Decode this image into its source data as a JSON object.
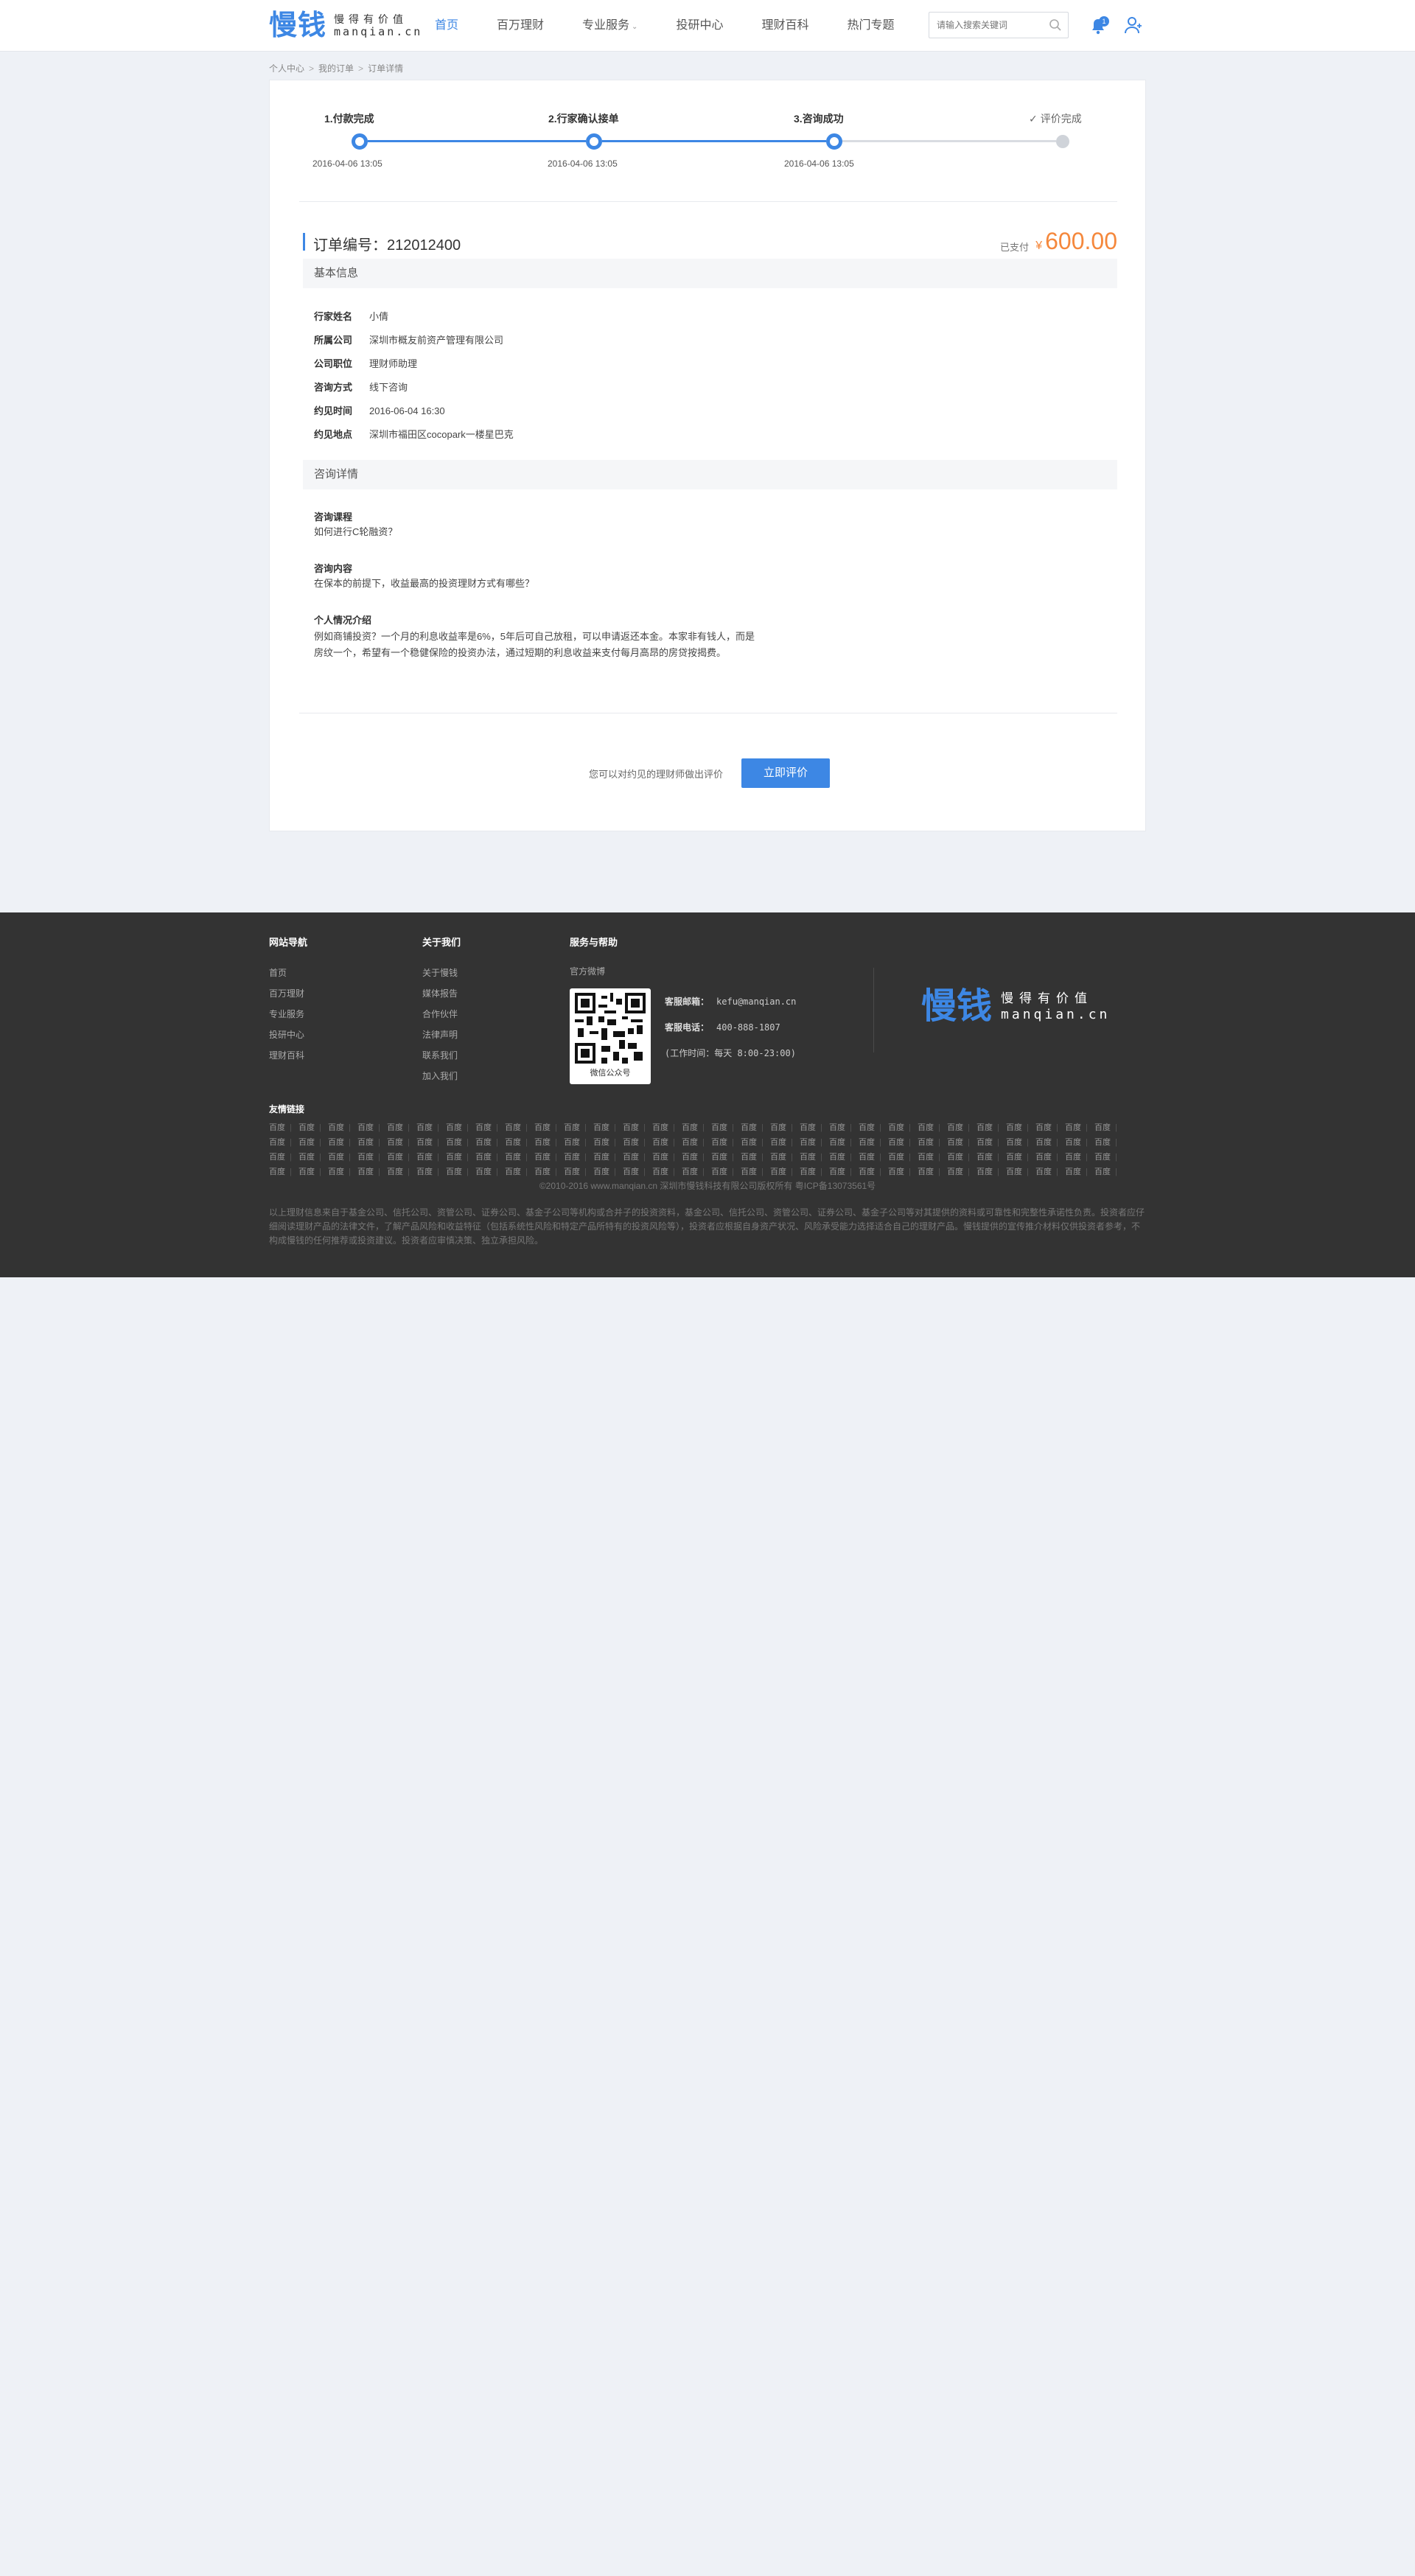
{
  "header": {
    "logo_cn": "慢钱",
    "logo_slogan": "慢得有价值",
    "logo_domain": "manqian.cn",
    "nav": [
      "首页",
      "百万理财",
      "专业服务",
      "投研中心",
      "理财百科",
      "热门专题"
    ],
    "search_placeholder": "请输入搜索关键词",
    "notification_count": "1"
  },
  "breadcrumb": [
    "个人中心",
    "我的订单",
    "订单详情"
  ],
  "progress": {
    "steps": [
      {
        "title": "1.付款完成",
        "date": "2016-04-06 13:05",
        "done": true
      },
      {
        "title": "2.行家确认接单",
        "date": "2016-04-06 13:05",
        "done": true
      },
      {
        "title": "3.咨询成功",
        "date": "2016-04-06 13:05",
        "done": true
      },
      {
        "title": "评价完成",
        "date": "",
        "done": false
      }
    ]
  },
  "order": {
    "label": "订单编号：212012400",
    "paid_label": "已支付",
    "currency": "¥",
    "amount": "600.00"
  },
  "basic_info": {
    "title": "基本信息",
    "rows": [
      {
        "label": "行家姓名",
        "value": "小倩"
      },
      {
        "label": "所属公司",
        "value": "深圳市概友前资产管理有限公司"
      },
      {
        "label": "公司职位",
        "value": "理财师助理"
      },
      {
        "label": "咨询方式",
        "value": "线下咨询"
      },
      {
        "label": "约见时间",
        "value": "2016-06-04 16:30"
      },
      {
        "label": "约见地点",
        "value": "深圳市福田区cocopark一楼星巴克"
      }
    ]
  },
  "consult_detail": {
    "title": "咨询详情",
    "course_title": "咨询课程",
    "course_text": "如何进行C轮融资？",
    "content_title": "咨询内容",
    "content_text": "在保本的前提下，收益最高的投资理财方式有哪些？",
    "personal_title": "个人情况介绍",
    "personal_line1": "例如商铺投资？一个月的利息收益率是6%，5年后可自己放租，可以申请返还本金。本家非有钱人，而是",
    "personal_line2": "房纹一个，希望有一个稳健保险的投资办法，通过短期的利息收益来支付每月高昂的房贷按揭费。"
  },
  "evaluate": {
    "hint": "您可以对约见的理财师做出评价",
    "button": "立即评价"
  },
  "footer": {
    "nav_title": "网站导航",
    "nav_links": [
      "首页",
      "百万理财",
      "专业服务",
      "投研中心",
      "理财百科"
    ],
    "about_title": "关于我们",
    "about_links": [
      "关于慢钱",
      "媒体报告",
      "合作伙伴",
      "法律声明",
      "联系我们",
      "加入我们"
    ],
    "service_title": "服务与帮助",
    "weibo": "官方微博",
    "qr_caption": "微信公众号",
    "email_label": "客服邮箱：",
    "email": "kefu@manqian.cn",
    "phone_label": "客服电话：",
    "phone": "400-888-1807",
    "hours": "(工作时间：每天 8:00-23:00)",
    "logo_cn": "慢钱",
    "logo_slogan": "慢得有价值",
    "logo_domain": "manqian.cn",
    "friend_title": "友情链接",
    "friend_link_text": "百度",
    "friend_link_count": 116,
    "copyright": "©2010-2016 www.manqian.cn 深圳市慢钱科技有限公司版权所有   粤ICP备13073561号",
    "disclaimer": "以上理财信息来自于基金公司、信托公司、资管公司、证券公司、基金子公司等机构或合并子的投资资料，基金公司、信托公司、资管公司、证券公司、基金子公司等对其提供的资料或可靠性和完整性承诺性负责。投资者应仔细阅读理财产品的法律文件，了解产品风险和收益特征（包括系统性风险和特定产品所特有的投资风险等），投资者应根据自身资产状况、风险承受能力选择适合自己的理财产品。慢钱提供的宣传推介材料仅供投资者参考，不构成慢钱的任何推荐或投资建议。投资者应审慎决策、独立承担风险。"
  },
  "colors": {
    "brand": "#3d87e4",
    "price": "#f5883c",
    "footer_bg": "#333333",
    "page_bg": "#eef1f6"
  }
}
